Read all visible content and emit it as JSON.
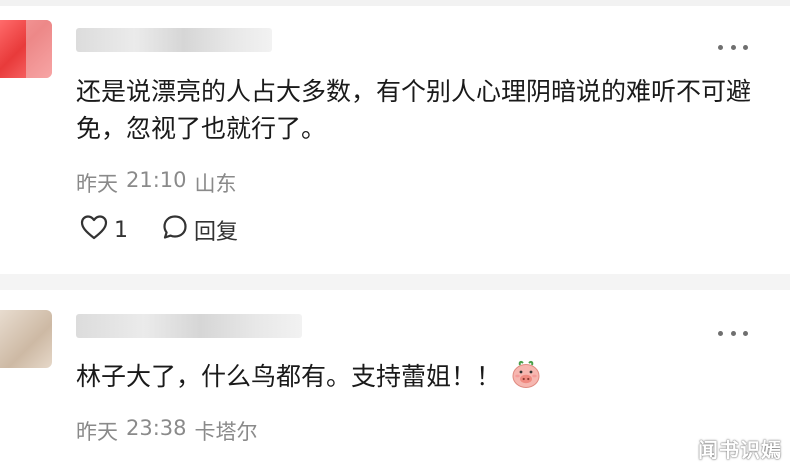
{
  "comments": [
    {
      "text": "还是说漂亮的人占大多数，有个别人心理阴暗说的难听不可避免，忽视了也就行了。",
      "date": "昨天",
      "time": "21:10",
      "location": "山东",
      "like_count": "1",
      "reply_label": "回复",
      "like_icon": "heart-outline",
      "reply_icon": "speech-bubble"
    },
    {
      "text": "林子大了，什么鸟都有。支持蕾姐！！",
      "emoji": "pig-face",
      "date": "昨天",
      "time": "23:38",
      "location": "卡塔尔"
    }
  ],
  "watermark": "闻书识嫣",
  "colors": {
    "text": "#1a1a1a",
    "meta": "#8a8a8a",
    "divider": "#f4f4f4"
  }
}
